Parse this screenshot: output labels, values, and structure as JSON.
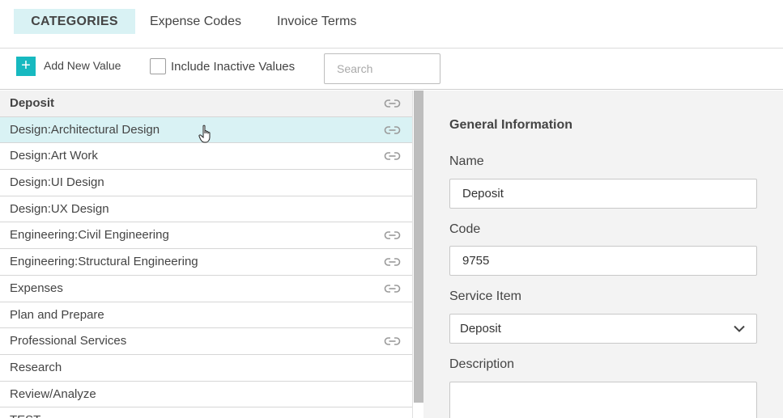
{
  "tabs": [
    {
      "label": "CATEGORIES",
      "active": true
    },
    {
      "label": "Expense Codes",
      "active": false
    },
    {
      "label": "Invoice Terms",
      "active": false
    }
  ],
  "toolbar": {
    "add_label": "Add New Value",
    "add_icon": "+",
    "include_inactive_label": "Include Inactive Values",
    "search_placeholder": "Search"
  },
  "list": {
    "items": [
      {
        "label": "Deposit",
        "linked": true,
        "state": "header"
      },
      {
        "label": "Design:Architectural Design",
        "linked": true,
        "state": "selected"
      },
      {
        "label": "Design:Art Work",
        "linked": true,
        "state": ""
      },
      {
        "label": "Design:UI Design",
        "linked": false,
        "state": ""
      },
      {
        "label": "Design:UX Design",
        "linked": false,
        "state": ""
      },
      {
        "label": "Engineering:Civil Engineering",
        "linked": true,
        "state": ""
      },
      {
        "label": "Engineering:Structural Engineering",
        "linked": true,
        "state": ""
      },
      {
        "label": "Expenses",
        "linked": true,
        "state": ""
      },
      {
        "label": "Plan and Prepare",
        "linked": false,
        "state": ""
      },
      {
        "label": "Professional Services",
        "linked": true,
        "state": ""
      },
      {
        "label": "Research",
        "linked": false,
        "state": ""
      },
      {
        "label": "Review/Analyze",
        "linked": false,
        "state": ""
      },
      {
        "label": "TEST",
        "linked": false,
        "state": ""
      }
    ]
  },
  "detail": {
    "section_title": "General Information",
    "name_label": "Name",
    "name_value": "Deposit",
    "code_label": "Code",
    "code_value": "9755",
    "service_item_label": "Service Item",
    "service_item_value": "Deposit",
    "description_label": "Description",
    "description_value": ""
  },
  "colors": {
    "accent": "#17b9c0",
    "selected_bg": "#d9f2f4",
    "panel_bg": "#f3f3f3"
  }
}
